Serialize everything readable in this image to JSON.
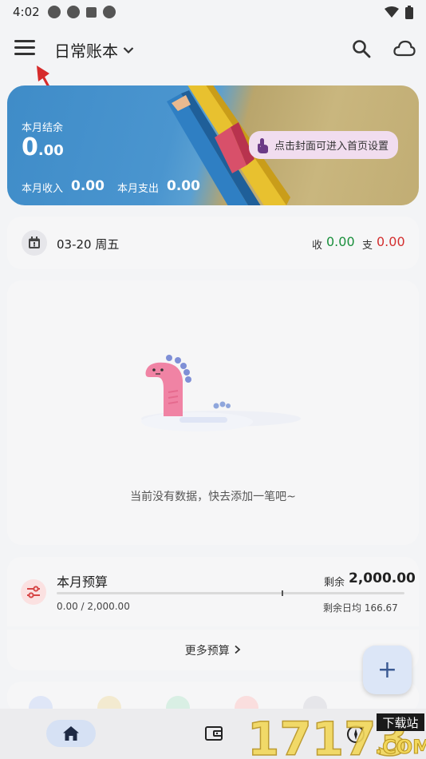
{
  "status_bar": {
    "time": "4:02"
  },
  "app_bar": {
    "book_name": "日常账本"
  },
  "cover": {
    "balance_label": "本月结余",
    "balance_int": "0",
    "balance_dec": ".00",
    "income_label": "本月收入",
    "income_value": "0.00",
    "expense_label": "本月支出",
    "expense_value": "0.00",
    "hint": "点击封面可进入首页设置"
  },
  "day_summary": {
    "date": "03-20 周五",
    "income_label": "收",
    "income_value": "0.00",
    "expense_label": "支",
    "expense_value": "0.00"
  },
  "empty_state": {
    "message": "当前没有数据，快去添加一笔吧~"
  },
  "budget": {
    "title": "本月预算",
    "remaining_label": "剩余",
    "remaining_value": "2,000.00",
    "used_total": "0.00 / 2,000.00",
    "daily_avg": "剩余日均 166.67",
    "progress_fraction": 0.0
  },
  "more_budget": {
    "label": "更多预算"
  },
  "fab": {
    "symbol": "+"
  },
  "watermark": {
    "text": "17173",
    "badge": "下载站",
    "domain": ".COM"
  },
  "colors": {
    "income": "#1a8f3c",
    "expense": "#d32f2f",
    "accent": "#3b5a93"
  }
}
